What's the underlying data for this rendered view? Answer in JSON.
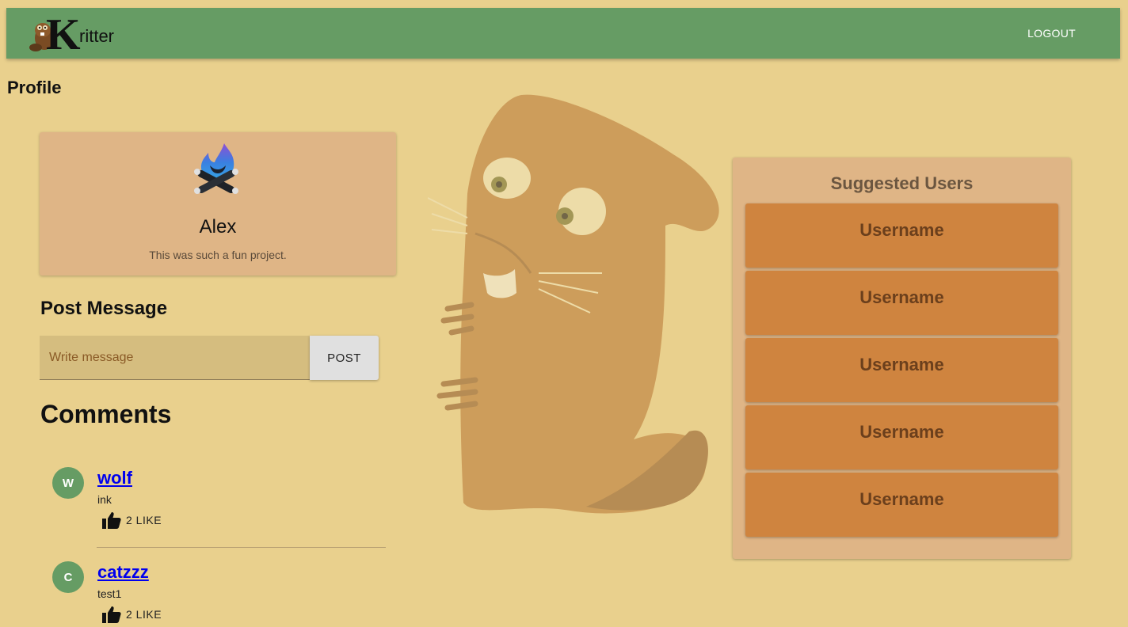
{
  "app": {
    "logo_text": "ritter",
    "logo_letter": "K",
    "logout_label": "LOGOUT"
  },
  "page": {
    "title": "Profile"
  },
  "profile": {
    "name": "Alex",
    "bio": "This was such a fun project."
  },
  "post": {
    "title": "Post Message",
    "placeholder": "Write message",
    "button_label": "POST"
  },
  "comments": {
    "title": "Comments",
    "items": [
      {
        "initial": "W",
        "user": "wolf",
        "text": "ink",
        "likes": "2 LIKE"
      },
      {
        "initial": "C",
        "user": "catzzz",
        "text": "test1",
        "likes": "2 LIKE"
      }
    ]
  },
  "suggested": {
    "title": "Suggested Users",
    "users": [
      "Username",
      "Username",
      "Username",
      "Username",
      "Username"
    ]
  },
  "colors": {
    "background": "#e9d08d",
    "appbar": "#669c64",
    "card": "#dfb586",
    "user_card": "#cf843f",
    "avatar": "#669c64"
  }
}
